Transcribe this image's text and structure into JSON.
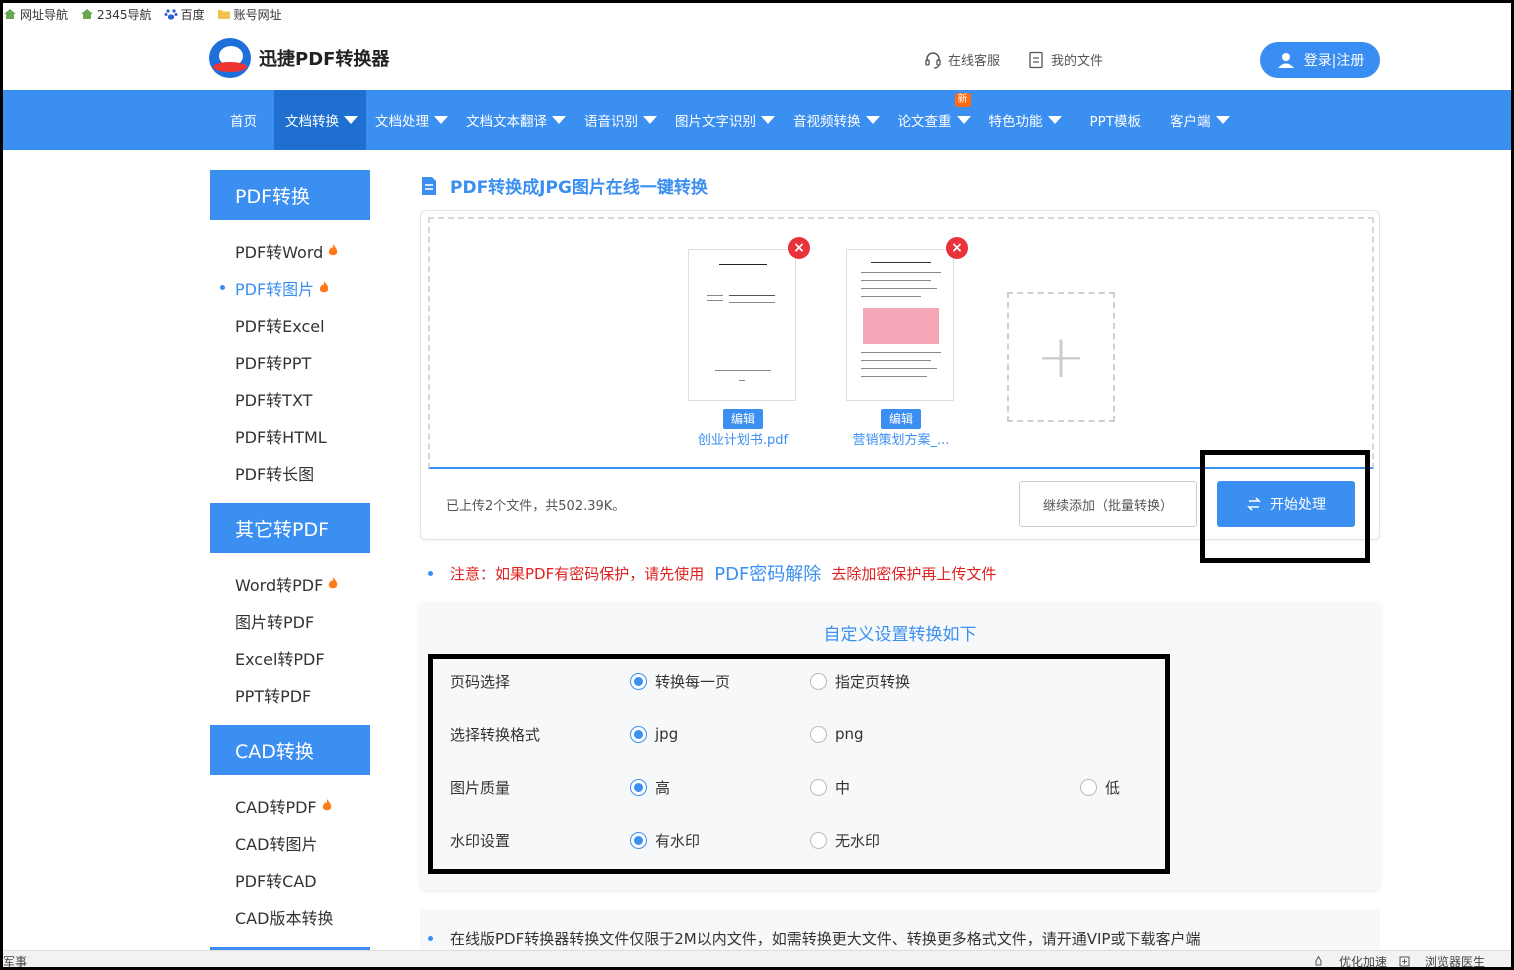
{
  "bookmarks": [
    {
      "label": "网址导航",
      "icon": "home-icon"
    },
    {
      "label": "2345导航",
      "icon": "home-icon"
    },
    {
      "label": "百度",
      "icon": "paw-icon"
    },
    {
      "label": "账号网址",
      "icon": "folder-icon"
    }
  ],
  "header": {
    "logo_text": "迅捷PDF转换器",
    "service_label": "在线客服",
    "files_label": "我的文件",
    "login_label": "登录|注册"
  },
  "nav": {
    "items": [
      {
        "label": "首页",
        "caret": false
      },
      {
        "label": "文档转换",
        "caret": true,
        "active": true
      },
      {
        "label": "文档处理",
        "caret": true
      },
      {
        "label": "文档文本翻译",
        "caret": true
      },
      {
        "label": "语音识别",
        "caret": true
      },
      {
        "label": "图片文字识别",
        "caret": true
      },
      {
        "label": "音视频转换",
        "caret": true
      },
      {
        "label": "论文查重",
        "caret": true,
        "badge": "新"
      },
      {
        "label": "特色功能",
        "caret": true
      },
      {
        "label": "PPT模板",
        "caret": false
      },
      {
        "label": "客户端",
        "caret": true
      }
    ]
  },
  "sidebar": {
    "groups": [
      {
        "title": "PDF转换",
        "items": [
          {
            "label": "PDF转Word",
            "hot": true
          },
          {
            "label": "PDF转图片",
            "hot": true,
            "active": true
          },
          {
            "label": "PDF转Excel"
          },
          {
            "label": "PDF转PPT"
          },
          {
            "label": "PDF转TXT"
          },
          {
            "label": "PDF转HTML"
          },
          {
            "label": "PDF转长图"
          }
        ]
      },
      {
        "title": "其它转PDF",
        "items": [
          {
            "label": "Word转PDF",
            "hot": true
          },
          {
            "label": "图片转PDF"
          },
          {
            "label": "Excel转PDF"
          },
          {
            "label": "PPT转PDF"
          }
        ]
      },
      {
        "title": "CAD转换",
        "items": [
          {
            "label": "CAD转PDF",
            "hot": true
          },
          {
            "label": "CAD转图片"
          },
          {
            "label": "PDF转CAD"
          },
          {
            "label": "CAD版本转换"
          }
        ]
      }
    ]
  },
  "main": {
    "title": "PDF转换成JPG图片在线一键转换",
    "files": [
      {
        "name": "创业计划书.pdf",
        "edit_label": "编辑"
      },
      {
        "name": "营销策划方案_...",
        "edit_label": "编辑"
      }
    ],
    "add_symbol": "+",
    "upload_info": "已上传2个文件，共502.39K。",
    "continue_label": "继续添加（批量转换）",
    "start_label": "开始处理",
    "notice_prefix": "注意：如果PDF有密码保护，请先使用",
    "notice_link": "PDF密码解除",
    "notice_suffix": "去除加密保护再上传文件"
  },
  "settings": {
    "title": "自定义设置转换如下",
    "rows": [
      {
        "label": "页码选择",
        "options": [
          {
            "label": "转换每一页",
            "checked": true
          },
          {
            "label": "指定页转换",
            "checked": false
          }
        ]
      },
      {
        "label": "选择转换格式",
        "options": [
          {
            "label": "jpg",
            "checked": true
          },
          {
            "label": "png",
            "checked": false
          }
        ]
      },
      {
        "label": "图片质量",
        "options": [
          {
            "label": "高",
            "checked": true
          },
          {
            "label": "中",
            "checked": false
          },
          {
            "label": "低",
            "checked": false
          }
        ]
      },
      {
        "label": "水印设置",
        "options": [
          {
            "label": "有水印",
            "checked": true
          },
          {
            "label": "无水印",
            "checked": false
          }
        ]
      }
    ]
  },
  "bottom_note": "在线版PDF转换器转换文件仅限于2M以内文件，如需转换更大文件、转换更多格式文件，请开通VIP或下载客户端",
  "statusbar": {
    "left": "军事",
    "right": [
      "优化加速",
      "浏览器医生"
    ]
  },
  "colors": {
    "primary": "#3b8ff1",
    "nav_active": "#1e6fd0",
    "danger": "#e8323c",
    "notice": "#e02020",
    "badge": "#ff6a13"
  }
}
